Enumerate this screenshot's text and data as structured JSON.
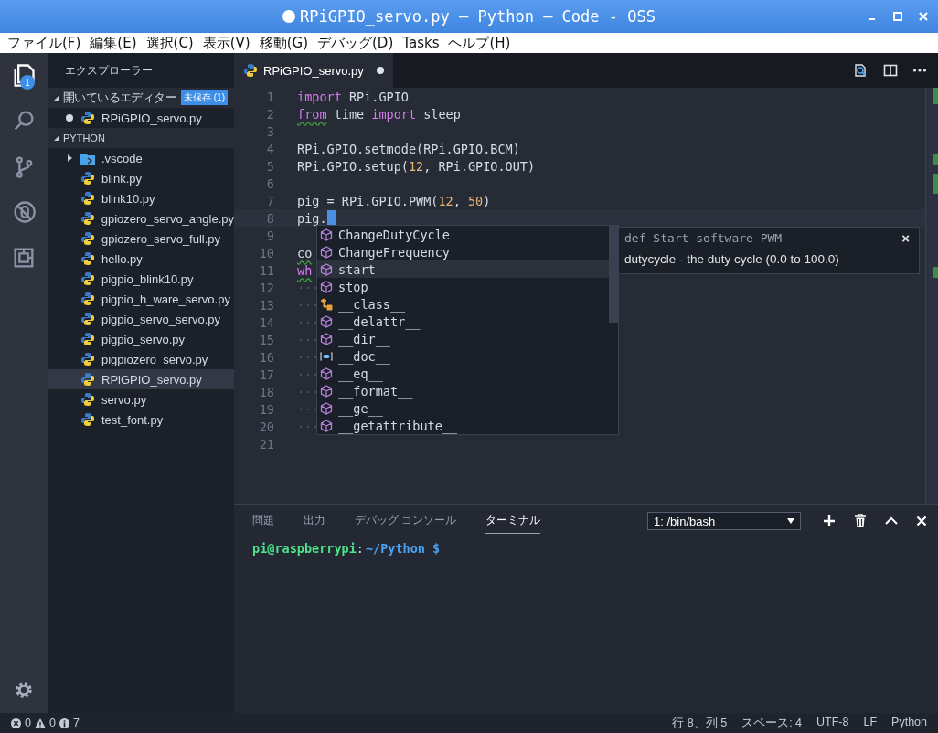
{
  "window": {
    "title": "RPiGPIO_servo.py — Python — Code - OSS",
    "dirty": true
  },
  "menu": [
    "ファイル(F)",
    "編集(E)",
    "選択(C)",
    "表示(V)",
    "移動(G)",
    "デバッグ(D)",
    "Tasks",
    "ヘルプ(H)"
  ],
  "activity_bar": [
    {
      "kind": "files",
      "selected": true,
      "badge": "1"
    },
    {
      "kind": "search",
      "selected": false
    },
    {
      "kind": "scm",
      "selected": false
    },
    {
      "kind": "debug",
      "selected": false
    },
    {
      "kind": "extensions",
      "selected": false
    }
  ],
  "sidebar": {
    "title": "エクスプローラー",
    "sections": [
      {
        "title": "開いているエディター",
        "expanded": true,
        "badge": "未保存 (1)",
        "items": [
          {
            "name": "RPiGPIO_servo.py",
            "kind": "python",
            "dirty": true,
            "selected": false
          }
        ]
      },
      {
        "title": "PYTHON",
        "expanded": true,
        "items": [
          {
            "name": ".vscode",
            "kind": "folder",
            "expanded": false,
            "selected": false
          },
          {
            "name": "blink.py",
            "kind": "python",
            "selected": false
          },
          {
            "name": "blink10.py",
            "kind": "python",
            "selected": false
          },
          {
            "name": "gpiozero_servo_angle.py",
            "kind": "python",
            "selected": false
          },
          {
            "name": "gpiozero_servo_full.py",
            "kind": "python",
            "selected": false
          },
          {
            "name": "hello.py",
            "kind": "python",
            "selected": false
          },
          {
            "name": "pigpio_blink10.py",
            "kind": "python",
            "selected": false
          },
          {
            "name": "pigpio_h_ware_servo.py",
            "kind": "python",
            "selected": false
          },
          {
            "name": "pigpio_servo_servo.py",
            "kind": "python",
            "selected": false
          },
          {
            "name": "pigpio_servo.py",
            "kind": "python",
            "selected": false
          },
          {
            "name": "pigpiozero_servo.py",
            "kind": "python",
            "selected": false
          },
          {
            "name": "RPiGPIO_servo.py",
            "kind": "python",
            "selected": true
          },
          {
            "name": "servo.py",
            "kind": "python",
            "selected": false
          },
          {
            "name": "test_font.py",
            "kind": "python",
            "selected": false
          }
        ]
      }
    ]
  },
  "tabs": [
    {
      "label": "RPiGPIO_servo.py",
      "dirty": true,
      "selected": true
    }
  ],
  "editor": {
    "lines": [
      {
        "number": "1",
        "tokens": [
          {
            "text": "import",
            "kind": "keyword"
          },
          {
            "text": " RPi.GPIO",
            "kind": "plain"
          }
        ]
      },
      {
        "number": "2",
        "tokens": [
          {
            "text": "from",
            "kind": "keyword",
            "warn": true
          },
          {
            "text": " time ",
            "kind": "plain"
          },
          {
            "text": "import",
            "kind": "keyword"
          },
          {
            "text": " sleep",
            "kind": "plain"
          }
        ]
      },
      {
        "number": "3"
      },
      {
        "number": "4",
        "tokens": [
          {
            "text": "RPi.GPIO.setmode(RPi.GPIO.BCM)",
            "kind": "plain"
          }
        ]
      },
      {
        "number": "5",
        "tokens": [
          {
            "text": "RPi.GPIO.setup(",
            "kind": "plain"
          },
          {
            "text": "12",
            "kind": "number"
          },
          {
            "text": ", RPi.GPIO.OUT)",
            "kind": "plain"
          }
        ]
      },
      {
        "number": "6"
      },
      {
        "number": "7",
        "tokens": [
          {
            "text": "pig = RPi.GPIO.PWM(",
            "kind": "plain"
          },
          {
            "text": "12",
            "kind": "number"
          },
          {
            "text": ", ",
            "kind": "plain"
          },
          {
            "text": "50",
            "kind": "number"
          },
          {
            "text": ")",
            "kind": "plain"
          }
        ]
      },
      {
        "number": "8",
        "tokens": [
          {
            "text": "pig.",
            "kind": "plain"
          }
        ],
        "cursor": true
      },
      {
        "number": "9"
      },
      {
        "number": "10",
        "tokens": [
          {
            "text": "co",
            "kind": "plain",
            "warn": true
          }
        ]
      },
      {
        "number": "11",
        "tokens": [
          {
            "text": "wh",
            "kind": "keyword",
            "warn": true
          }
        ]
      },
      {
        "number": "12",
        "tokens": [
          {
            "text": "···",
            "kind": "whitespace"
          }
        ]
      },
      {
        "number": "13",
        "tokens": [
          {
            "text": "···",
            "kind": "whitespace"
          }
        ]
      },
      {
        "number": "14",
        "tokens": [
          {
            "text": "···",
            "kind": "whitespace"
          }
        ]
      },
      {
        "number": "15",
        "tokens": [
          {
            "text": "···",
            "kind": "whitespace"
          }
        ]
      },
      {
        "number": "16",
        "tokens": [
          {
            "text": "···",
            "kind": "whitespace"
          }
        ]
      },
      {
        "number": "17",
        "tokens": [
          {
            "text": "···",
            "kind": "whitespace"
          }
        ]
      },
      {
        "number": "18",
        "tokens": [
          {
            "text": "···",
            "kind": "whitespace"
          }
        ]
      },
      {
        "number": "19",
        "tokens": [
          {
            "text": "···",
            "kind": "whitespace"
          }
        ]
      },
      {
        "number": "20",
        "tokens": [
          {
            "text": "···",
            "kind": "whitespace"
          }
        ]
      },
      {
        "number": "21"
      }
    ],
    "suggestions": [
      {
        "label": "ChangeDutyCycle",
        "kind": "method",
        "selected": false
      },
      {
        "label": "ChangeFrequency",
        "kind": "method",
        "selected": false
      },
      {
        "label": "start",
        "kind": "method",
        "selected": true
      },
      {
        "label": "stop",
        "kind": "method",
        "selected": false
      },
      {
        "label": "__class__",
        "kind": "class",
        "selected": false
      },
      {
        "label": "__delattr__",
        "kind": "method",
        "selected": false
      },
      {
        "label": "__dir__",
        "kind": "method",
        "selected": false
      },
      {
        "label": "__doc__",
        "kind": "field",
        "selected": false
      },
      {
        "label": "__eq__",
        "kind": "method",
        "selected": false
      },
      {
        "label": "__format__",
        "kind": "method",
        "selected": false
      },
      {
        "label": "__ge__",
        "kind": "method",
        "selected": false
      },
      {
        "label": "__getattribute__",
        "kind": "method",
        "selected": false
      }
    ],
    "details": {
      "signature": "def Start software PWM",
      "description": "dutycycle - the duty cycle (0.0 to 100.0)",
      "close": "×"
    }
  },
  "panel": {
    "tabs": [
      {
        "label": "問題",
        "selected": false
      },
      {
        "label": "出力",
        "selected": false
      },
      {
        "label": "デバッグ コンソール",
        "selected": false
      },
      {
        "label": "ターミナル",
        "selected": true
      }
    ],
    "terminal_select": "1: /bin/bash",
    "prompt": {
      "user_host": "pi@raspberrypi",
      "separator": ":",
      "path": "~/Python $"
    }
  },
  "status_bar": {
    "errors": "0",
    "warnings": "0",
    "infos": "7",
    "items": [
      "行 8、列 5",
      "スペース: 4",
      "UTF-8",
      "LF",
      "Python"
    ]
  }
}
